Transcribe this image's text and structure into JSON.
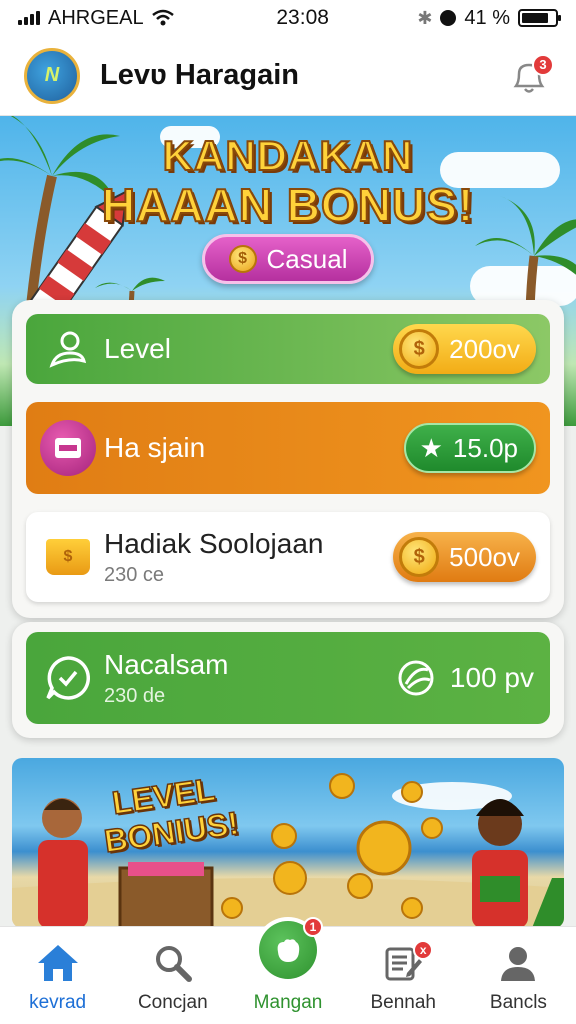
{
  "status_bar": {
    "carrier": "AHRGEAL",
    "time": "23:08",
    "battery": "41 %",
    "battery_level": 0.8
  },
  "header": {
    "title": "Levʋ Haragain",
    "notification_count": "3",
    "logo_text": "N"
  },
  "hero": {
    "title_line1": "KANDAKAN",
    "title_line2": "HAAAN BONUS!",
    "chip_label": "Casual",
    "chip_icon_text": "$"
  },
  "rewards": [
    {
      "label": "Level",
      "value": "200ov",
      "color": "#5fb34a",
      "pill": "yellow"
    },
    {
      "label": "Ha sjain",
      "value": "15.0p",
      "color": "#e38517",
      "pill": "green"
    },
    {
      "label": "Hadiak Soolojaan",
      "sub": "230 ce",
      "value": "500ov",
      "pill": "orange"
    },
    {
      "label": "Nacalsam",
      "sub": "230 de",
      "value": "100 pv",
      "color": "#56ad3f"
    }
  ],
  "banner": {
    "line1": "LEVEL",
    "line2": "BONIUS!"
  },
  "nav": {
    "items": [
      {
        "label": "kevrad",
        "icon": "home-icon",
        "active": true
      },
      {
        "label": "Concjan",
        "icon": "search-icon"
      },
      {
        "label": "Mangan",
        "icon": "fist-icon",
        "badge": "1"
      },
      {
        "label": "Bennah",
        "icon": "edit-document-icon",
        "badge": "x"
      },
      {
        "label": "Bancls",
        "icon": "profile-icon"
      }
    ]
  }
}
